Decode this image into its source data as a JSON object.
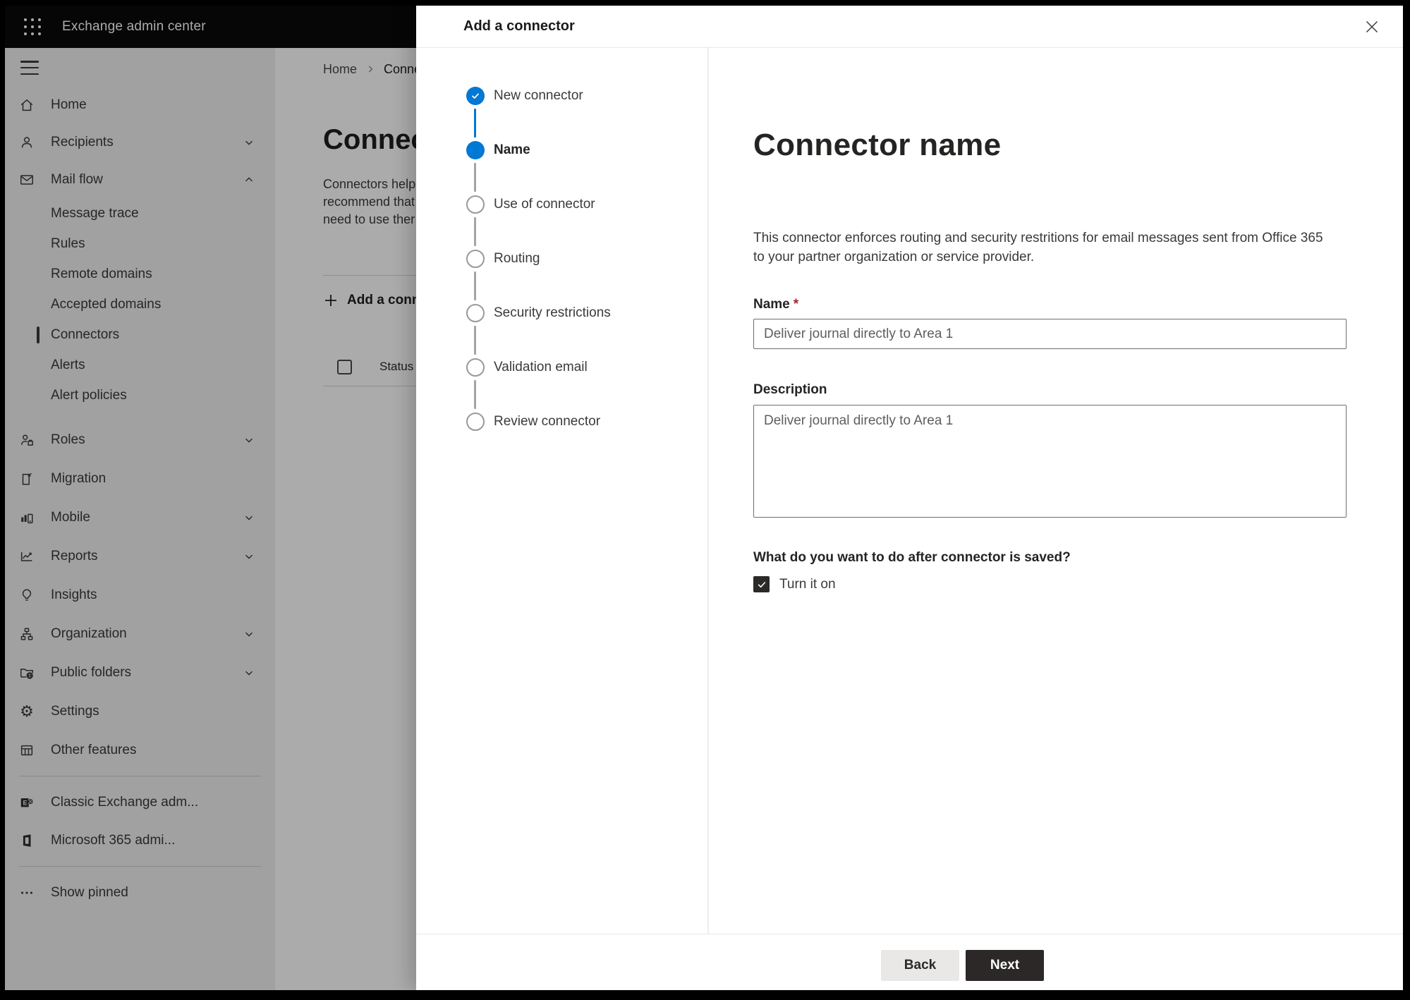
{
  "app": {
    "title": "Exchange admin center"
  },
  "colors": {
    "accent_blue": "#0078d4",
    "required_red": "#a4262c",
    "topbar": "#000000",
    "next_button": "#2b2827",
    "back_button": "#e9e8e7",
    "checkbox_dark": "#2b2a29"
  },
  "page": {
    "breadcrumb": [
      "Home",
      "Conne"
    ],
    "title": "Connec",
    "intro": "Connectors help\nrecommend that\nneed to use ther",
    "add_button": "Add a conn",
    "status_column": "Status"
  },
  "sidebar": {
    "items": [
      {
        "label": "Home",
        "icon": "home"
      },
      {
        "label": "Recipients",
        "icon": "person",
        "chevron": "down"
      },
      {
        "label": "Mail flow",
        "icon": "mail",
        "chevron": "up"
      },
      {
        "label": "Message trace"
      },
      {
        "label": "Rules"
      },
      {
        "label": "Remote domains"
      },
      {
        "label": "Accepted domains"
      },
      {
        "label": "Connectors",
        "selected": true
      },
      {
        "label": "Alerts"
      },
      {
        "label": "Alert policies"
      },
      {
        "label": "Roles",
        "icon": "roles",
        "chevron": "down"
      },
      {
        "label": "Migration",
        "icon": "migration"
      },
      {
        "label": "Mobile",
        "icon": "mobile",
        "chevron": "down"
      },
      {
        "label": "Reports",
        "icon": "reports",
        "chevron": "down"
      },
      {
        "label": "Insights",
        "icon": "insights"
      },
      {
        "label": "Organization",
        "icon": "organization",
        "chevron": "down"
      },
      {
        "label": "Public folders",
        "icon": "public-folders",
        "chevron": "down"
      },
      {
        "label": "Settings",
        "icon": "gear"
      },
      {
        "label": "Other features",
        "icon": "table-grid"
      },
      {
        "label": "Classic Exchange adm...",
        "icon": "exchange-logo"
      },
      {
        "label": "Microsoft 365 admi...",
        "icon": "office-logo"
      },
      {
        "label": "Show pinned",
        "icon": "ellipsis"
      }
    ]
  },
  "dialog": {
    "title": "Add a connector",
    "steps": [
      {
        "label": "New connector",
        "state": "completed"
      },
      {
        "label": "Name",
        "state": "current"
      },
      {
        "label": "Use of connector",
        "state": "upcoming"
      },
      {
        "label": "Routing",
        "state": "upcoming"
      },
      {
        "label": "Security restrictions",
        "state": "upcoming"
      },
      {
        "label": "Validation email",
        "state": "upcoming"
      },
      {
        "label": "Review connector",
        "state": "upcoming"
      }
    ],
    "heading": "Connector name",
    "description": "This connector enforces routing and security restritions for email messages sent from Office 365\nto your partner organization or service provider.",
    "name_label": "Name",
    "required_mark": "*",
    "name_value": "Deliver journal directly to Area 1",
    "description_label": "Description",
    "description_value": "Deliver journal directly to Area 1",
    "question": "What do you want to do after connector is saved?",
    "checkbox_label": "Turn it on",
    "checkbox_checked": true,
    "back_label": "Back",
    "next_label": "Next"
  }
}
